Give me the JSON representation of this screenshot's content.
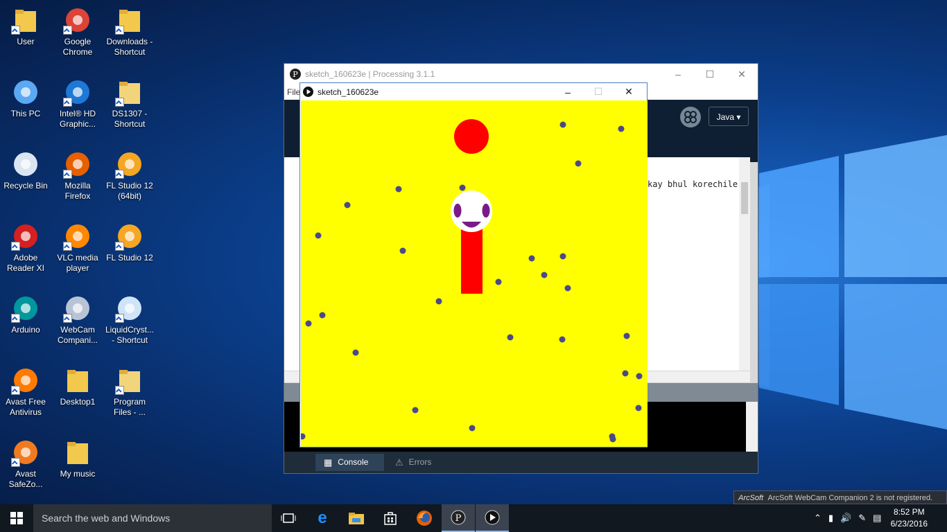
{
  "desktop": {
    "icons": [
      {
        "label": "User",
        "icon": "user-folder-icon"
      },
      {
        "label": "Google Chrome",
        "icon": "chrome-icon"
      },
      {
        "label": "Downloads - Shortcut",
        "icon": "downloads-folder-icon"
      },
      {
        "label": "This PC",
        "icon": "computer-icon"
      },
      {
        "label": "Intel® HD Graphic...",
        "icon": "intel-graphics-icon"
      },
      {
        "label": "DS1307 - Shortcut",
        "icon": "folder-shortcut-icon"
      },
      {
        "label": "Recycle Bin",
        "icon": "recycle-bin-icon"
      },
      {
        "label": "Mozilla Firefox",
        "icon": "firefox-icon"
      },
      {
        "label": "FL Studio 12 (64bit)",
        "icon": "fl-studio-icon"
      },
      {
        "label": "Adobe Reader XI",
        "icon": "adobe-reader-icon"
      },
      {
        "label": "VLC media player",
        "icon": "vlc-icon"
      },
      {
        "label": "FL Studio 12",
        "icon": "fl-studio-icon"
      },
      {
        "label": "Arduino",
        "icon": "arduino-icon"
      },
      {
        "label": "WebCam Compani...",
        "icon": "webcam-icon"
      },
      {
        "label": "LiquidCryst... - Shortcut",
        "icon": "document-shortcut-icon"
      },
      {
        "label": "Avast Free Antivirus",
        "icon": "avast-icon"
      },
      {
        "label": "Desktop1",
        "icon": "folder-icon"
      },
      {
        "label": "Program Files - ...",
        "icon": "folder-shortcut-icon"
      },
      {
        "label": "Avast SafeZo...",
        "icon": "avast-safezone-icon"
      },
      {
        "label": "My music",
        "icon": "folder-icon"
      }
    ]
  },
  "ide": {
    "title": "sketch_160623e | Processing 3.1.1",
    "menu_partial": "File",
    "mode": "Java ▾",
    "code_visible": "kay bhul korechile",
    "tabs": {
      "console": "Console",
      "errors": "Errors"
    }
  },
  "sketch": {
    "title": "sketch_160623e",
    "background_color": "#ffff00",
    "dot_color": "#4a4a8a"
  },
  "taskbar": {
    "search_placeholder": "Search the web and Windows",
    "time": "8:52 PM",
    "date": "6/23/2016"
  },
  "notification": {
    "brand": "ArcSoft",
    "text": "ArcSoft WebCam Companion 2 is not registered."
  }
}
